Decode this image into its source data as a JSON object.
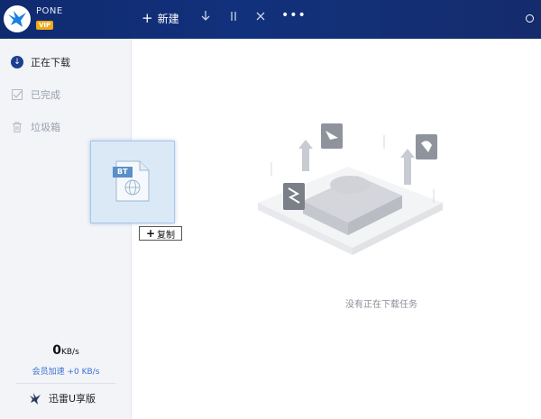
{
  "titlebar": {
    "user_name": "PONE",
    "vip_badge": "VIP",
    "new_label": "新建",
    "more_label": "•••"
  },
  "sidebar": {
    "items": [
      {
        "label": "正在下载",
        "icon": "download-icon",
        "active": true
      },
      {
        "label": "已完成",
        "icon": "check-icon",
        "active": false
      },
      {
        "label": "垃圾箱",
        "icon": "trash-icon",
        "active": false
      }
    ],
    "speed_value": "0",
    "speed_unit": "KB/s",
    "vip_speed": "会员加速 +0 KB/s",
    "u_version_label": "迅雷U享版"
  },
  "main": {
    "empty_text": "没有正在下载任务"
  },
  "drag": {
    "file_tag": "BT",
    "copy_label": "复制"
  },
  "colors": {
    "titlebar": "#12317c",
    "accent": "#1d3f8f",
    "vip": "#f2a91c"
  }
}
